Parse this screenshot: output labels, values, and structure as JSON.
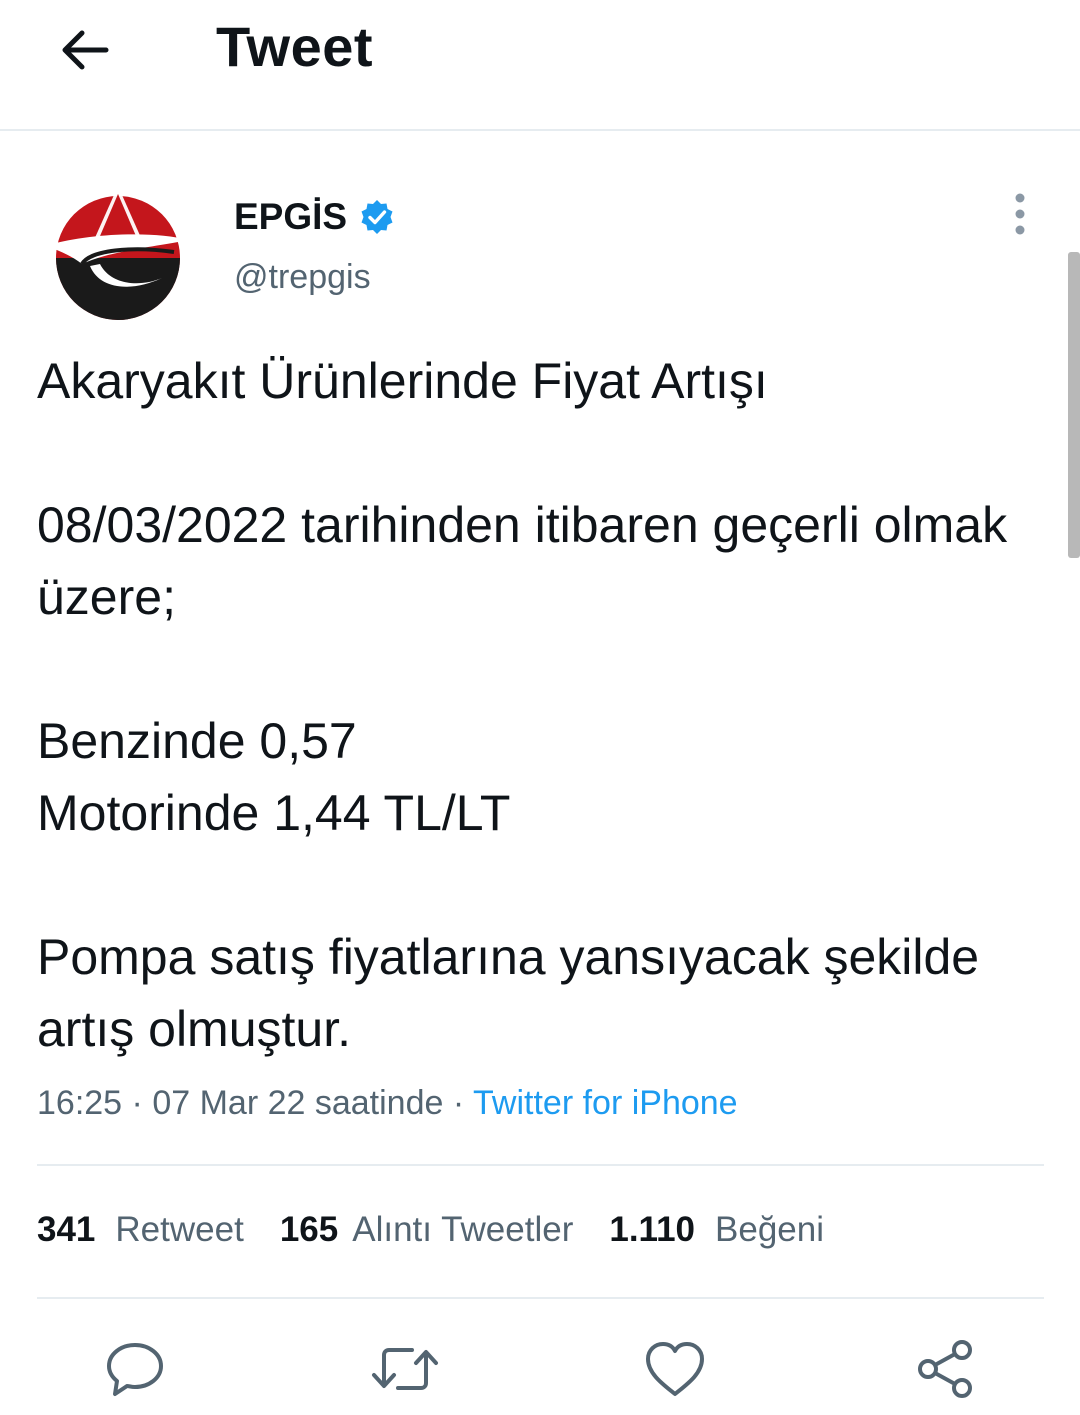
{
  "header": {
    "title": "Tweet",
    "back_icon": "arrow-left-icon"
  },
  "author": {
    "name": "EPGİS",
    "handle": "@trepgis",
    "verified_color": "#1d9bf0",
    "avatar_colors": {
      "red": "#c4161c",
      "black": "#1a1a1a"
    }
  },
  "tweet": {
    "text": "Akaryakıt Ürünlerinde Fiyat Artışı\n\n08/03/2022 tarihinden itibaren geçerli olmak üzere;\n\nBenzinde 0,57\nMotorinde 1,44 TL/LT\n\nPompa satış fiyatlarına yansıyacak şekilde artış olmuştur.",
    "time": "16:25",
    "separator": "·",
    "date": "07 Mar 22 saatinde",
    "source": "Twitter for iPhone"
  },
  "stats": {
    "retweets_count": "341",
    "retweets_label": "Retweet",
    "quotes_count": "165",
    "quotes_label": "Alıntı Tweetler",
    "likes_count": "1.110",
    "likes_label": "Beğeni"
  },
  "actions": {
    "reply_icon": "reply-icon",
    "retweet_icon": "retweet-icon",
    "like_icon": "heart-icon",
    "share_icon": "share-icon"
  },
  "colors": {
    "text": "#0f1419",
    "secondary": "#536471",
    "link": "#1d9bf0",
    "divider": "#e6ecf0"
  }
}
